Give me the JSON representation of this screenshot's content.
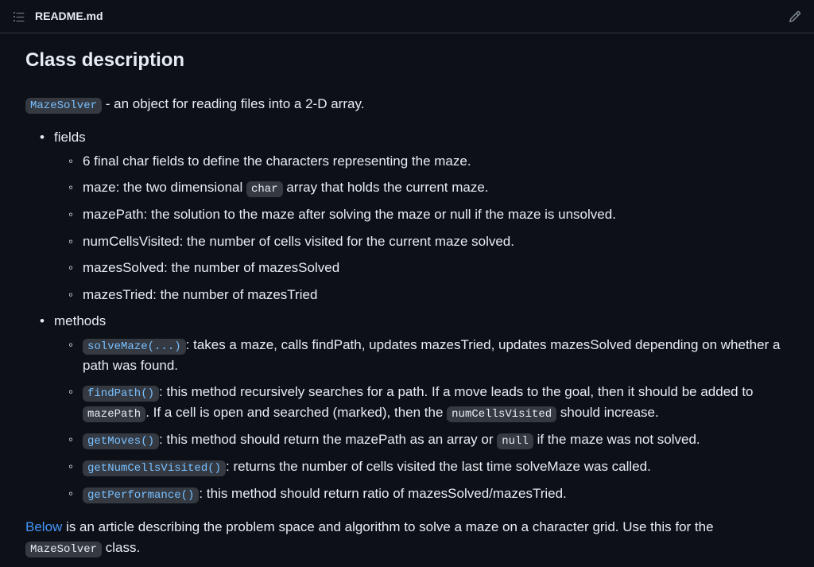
{
  "header": {
    "filename": "README.md"
  },
  "heading": "Class description",
  "intro": {
    "class_code": "MazeSolver",
    "after": " - an object for reading files into a 2-D array."
  },
  "fields": {
    "label": "fields",
    "items": {
      "i0": "6 final char fields to define the characters representing the maze.",
      "i1_pre": "maze: the two dimensional ",
      "i1_code": "char",
      "i1_post": " array that holds the current maze.",
      "i2": "mazePath: the solution to the maze after solving the maze or null if the maze is unsolved.",
      "i3": "numCellsVisited: the number of cells visited for the current maze solved.",
      "i4": "mazesSolved: the number of mazesSolved",
      "i5": "mazesTried: the number of mazesTried"
    }
  },
  "methods": {
    "label": "methods",
    "m0": {
      "code": "solveMaze(...)",
      "after": ": takes a maze, calls findPath, updates mazesTried, updates mazesSolved depending on whether a path was found."
    },
    "m1": {
      "code": "findPath()",
      "seg1": ": this method recursively searches for a path. If a move leads to the goal, then it should be added to ",
      "code2": "mazePath",
      "seg2": ". If a cell is open and searched (marked), then the ",
      "code3": "numCellsVisited",
      "seg3": " should increase."
    },
    "m2": {
      "code": "getMoves()",
      "seg1": ": this method should return the mazePath as an array or ",
      "code2": "null",
      "seg2": " if the maze was not solved."
    },
    "m3": {
      "code": "getNumCellsVisited()",
      "after": ": returns the number of cells visited the last time solveMaze was called."
    },
    "m4": {
      "code": "getPerformance()",
      "after": ": this method should return ratio of mazesSolved/mazesTried."
    }
  },
  "bottom": {
    "link": "Below",
    "seg1": " is an article describing the problem space and algorithm to solve a maze on a character grid. Use this for the ",
    "code": "MazeSolver",
    "seg2": " class."
  }
}
